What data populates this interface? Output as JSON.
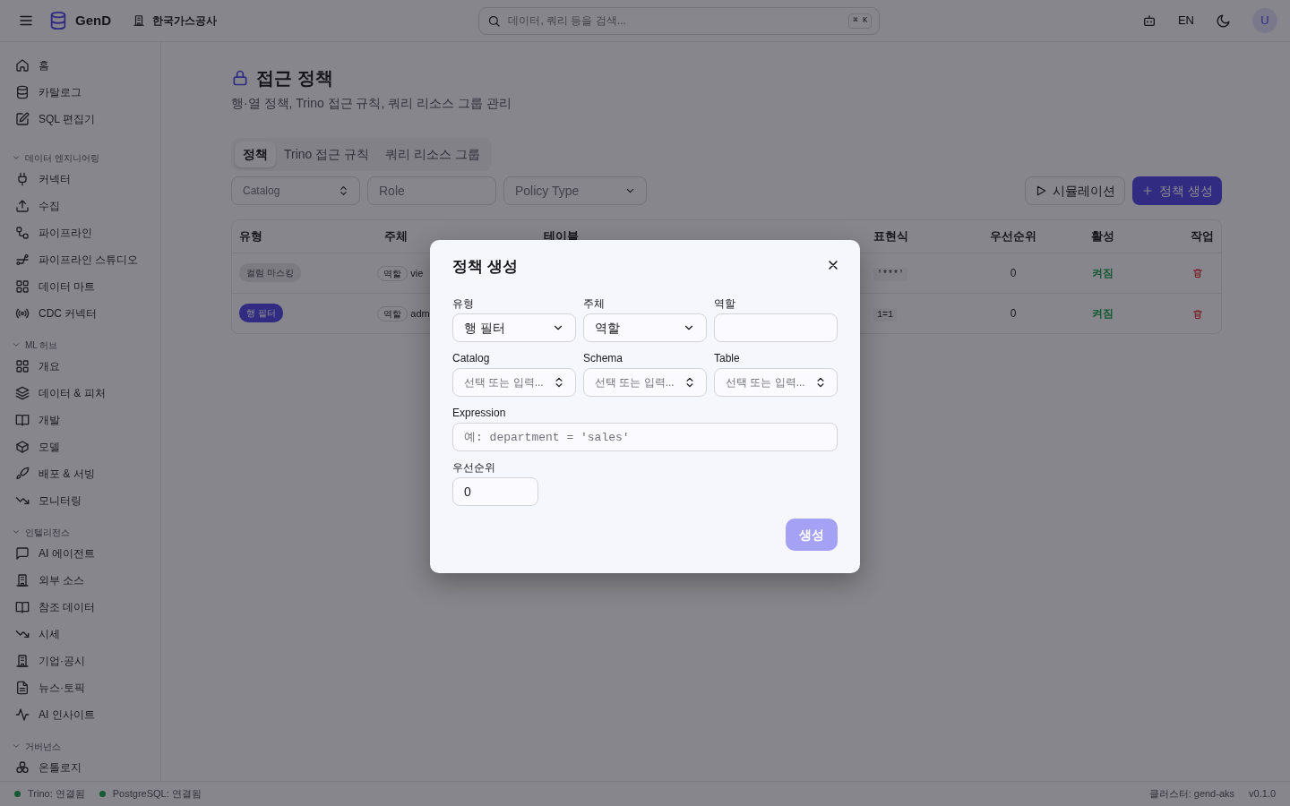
{
  "topbar": {
    "app_name": "GenD",
    "org": "한국가스공사",
    "search": {
      "placeholder": "데이터, 쿼리 등을 검색...",
      "shortcut": "⌘ K"
    },
    "language": "EN",
    "avatar": "U"
  },
  "sidebar": {
    "items": [
      {
        "label": "홈"
      },
      {
        "label": "카탈로그"
      },
      {
        "label": "SQL 편집기"
      }
    ],
    "sections": [
      {
        "title": "데이터 엔지니어링",
        "expanded": true,
        "items": [
          {
            "label": "커넥터"
          },
          {
            "label": "수집"
          },
          {
            "label": "파이프라인"
          },
          {
            "label": "파이프라인 스튜디오"
          },
          {
            "label": "데이터 마트"
          },
          {
            "label": "CDC 커넥터"
          }
        ]
      },
      {
        "title": "ML 허브",
        "expanded": true,
        "items": [
          {
            "label": "개요"
          },
          {
            "label": "데이터 & 피처"
          },
          {
            "label": "개발"
          },
          {
            "label": "모델"
          },
          {
            "label": "배포 & 서빙"
          },
          {
            "label": "모니터링"
          }
        ]
      },
      {
        "title": "인텔리전스",
        "expanded": true,
        "items": [
          {
            "label": "AI 에이전트"
          },
          {
            "label": "외부 소스"
          },
          {
            "label": "참조 데이터"
          },
          {
            "label": "시세"
          },
          {
            "label": "기업·공시"
          },
          {
            "label": "뉴스·토픽"
          },
          {
            "label": "AI 인사이트"
          }
        ]
      },
      {
        "title": "거버넌스",
        "expanded": true,
        "items": [
          {
            "label": "온톨로지"
          }
        ]
      }
    ]
  },
  "page": {
    "title": "접근 정책",
    "subtitle": "행·열 정책, Trino 접근 규칙, 쿼리 리소스 그룹 관리",
    "tabs": [
      {
        "label": "정책",
        "selected": true
      },
      {
        "label": "Trino 접근 규칙",
        "selected": false
      },
      {
        "label": "쿼리 리소스 그룹",
        "selected": false
      }
    ],
    "filters": [
      {
        "kind": "combobox",
        "placeholder": "Catalog"
      },
      {
        "kind": "input",
        "placeholder": "Role"
      },
      {
        "kind": "select",
        "placeholder": "Policy Type"
      }
    ],
    "buttons": [
      {
        "kind": "outline",
        "label": "시뮬레이션"
      },
      {
        "kind": "primary",
        "label": "정책 생성"
      }
    ],
    "table": {
      "columns": [
        "유형",
        "주체",
        "테이블",
        "표현식",
        "우선순위",
        "활성",
        "작업"
      ],
      "rows": [
        {
          "type": {
            "kind": "column_mask",
            "label": "컬럼 마스킹"
          },
          "subject_badge": "역할",
          "subject": "vie",
          "expression": "'***'",
          "priority": "0",
          "active": "켜짐"
        },
        {
          "type": {
            "kind": "row_filter",
            "label": "행 필터"
          },
          "subject_badge": "역할",
          "subject": "adm",
          "expression": "1=1",
          "priority": "0",
          "active": "켜짐"
        }
      ]
    }
  },
  "modal": {
    "title": "정책 생성",
    "fields": [
      {
        "kind": "select",
        "label": "유형",
        "value": "행 필터"
      },
      {
        "kind": "select",
        "label": "주체",
        "value": "역할"
      },
      {
        "kind": "input",
        "label": "역할"
      },
      {
        "kind": "combobox",
        "label": "Catalog",
        "placeholder": "선택 또는 입력..."
      },
      {
        "kind": "combobox",
        "label": "Schema",
        "placeholder": "선택 또는 입력..."
      },
      {
        "kind": "combobox",
        "label": "Table",
        "placeholder": "선택 또는 입력..."
      },
      {
        "kind": "code",
        "label": "Expression",
        "placeholder": "예: department = 'sales'"
      },
      {
        "kind": "number",
        "label": "우선순위",
        "value": "0"
      }
    ],
    "submit": {
      "label": "생성",
      "disabled": true
    }
  },
  "status_bar": {
    "connections": [
      {
        "label": "Trino: 연결됨"
      },
      {
        "label": "PostgreSQL: 연결됨"
      }
    ],
    "cluster": "클러스터: gend-aks",
    "version": "v0.1.0"
  }
}
